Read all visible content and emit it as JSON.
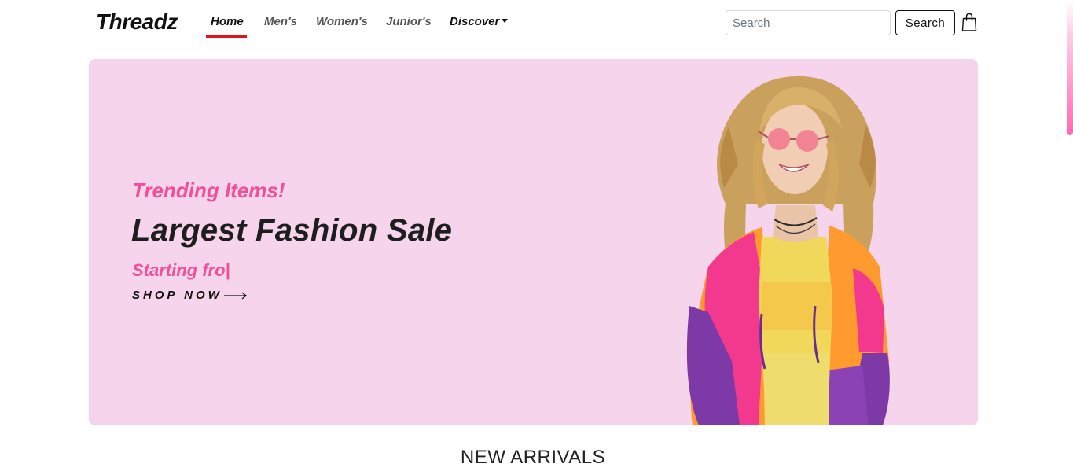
{
  "brand": "Threadz",
  "nav": {
    "items": [
      {
        "label": "Home"
      },
      {
        "label": "Men's"
      },
      {
        "label": "Women's"
      },
      {
        "label": "Junior's"
      },
      {
        "label": "Discover"
      }
    ]
  },
  "search": {
    "placeholder": "Search",
    "button_label": "Search"
  },
  "hero": {
    "trending": "Trending Items!",
    "title": "Largest Fashion Sale",
    "starting": "Starting fro|",
    "shop_now": "SHOP NOW"
  },
  "section": {
    "title": "NEW ARRIVALS"
  },
  "icons": {
    "cart": "shopping-bag-icon",
    "arrow": "arrow-right-icon",
    "dropdown": "caret-down-icon"
  },
  "colors": {
    "accent_pink": "#f0509a",
    "hero_bg": "#f5d4ec",
    "nav_underline": "#e0141b",
    "text_dark": "#1e1e1e"
  }
}
